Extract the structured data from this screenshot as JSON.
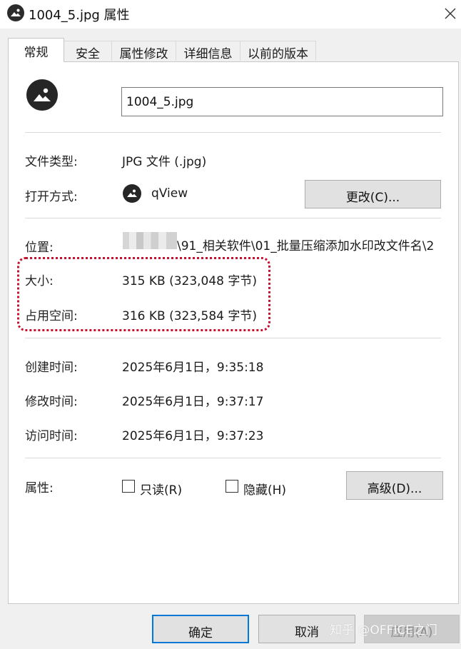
{
  "window": {
    "title": "1004_5.jpg 属性"
  },
  "tabs": [
    {
      "label": "常规",
      "active": true
    },
    {
      "label": "安全",
      "active": false
    },
    {
      "label": "属性修改",
      "active": false
    },
    {
      "label": "详细信息",
      "active": false
    },
    {
      "label": "以前的版本",
      "active": false
    }
  ],
  "general": {
    "filename": "1004_5.jpg",
    "file_type_label": "文件类型:",
    "file_type_value": "JPG 文件 (.jpg)",
    "opens_with_label": "打开方式:",
    "opens_with_value": "qView",
    "change_button": "更改(C)...",
    "location_label": "位置:",
    "location_value": "\\91_相关软件\\01_批量压缩添加水印改文件名\\2",
    "size_label": "大小:",
    "size_value": "315 KB (323,048 字节)",
    "size_on_disk_label": "占用空间:",
    "size_on_disk_value": "316 KB (323,584 字节)",
    "created_label": "创建时间:",
    "created_value": "2025年6月1日，9:35:18",
    "modified_label": "修改时间:",
    "modified_value": "2025年6月1日，9:37:17",
    "accessed_label": "访问时间:",
    "accessed_value": "2025年6月1日，9:37:23",
    "attributes_label": "属性:",
    "readonly_label": "只读(R)",
    "readonly_checked": false,
    "hidden_label": "隐藏(H)",
    "hidden_checked": false,
    "advanced_button": "高级(D)..."
  },
  "footer": {
    "ok": "确定",
    "cancel": "取消",
    "apply": "应用(A)"
  },
  "watermark": "知乎 @OFFICE之门",
  "colors": {
    "highlight": "#c8102e",
    "ok_border": "#0078d7"
  }
}
